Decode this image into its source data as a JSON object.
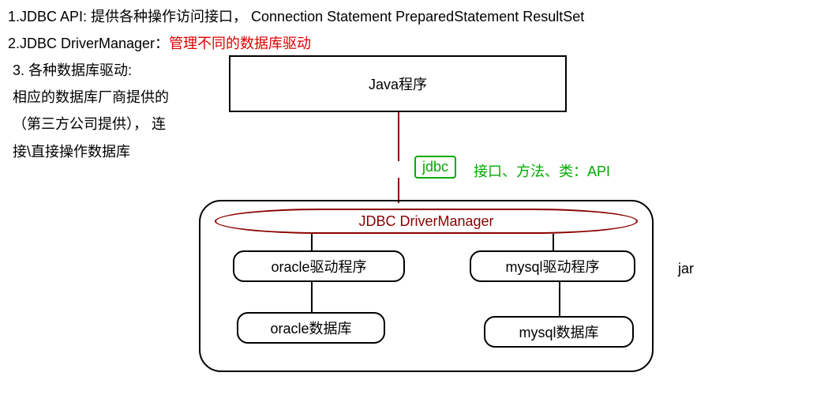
{
  "list": {
    "item1": "1.JDBC API: 提供各种操作访问接口，   Connection   Statement   PreparedStatement  ResultSet",
    "item2_prefix": " 2.JDBC DriverManager：",
    "item2_red": "管理不同的数据库驱动",
    "item3_line1": "3. 各种数据库驱动:",
    "item3_line2": "相应的数据库厂商提供的",
    "item3_line3": "（第三方公司提供）， 连",
    "item3_line4": "接\\直接操作数据库"
  },
  "diagram": {
    "java_box": "Java程序",
    "jdbc_label": "jdbc",
    "api_label": "接口、方法、类：API",
    "driver_manager": "JDBC DriverManager",
    "oracle_driver": "oracle驱动程序",
    "mysql_driver": "mysql驱动程序",
    "oracle_db": "oracle数据库",
    "mysql_db": "mysql数据库",
    "jar": "jar"
  }
}
